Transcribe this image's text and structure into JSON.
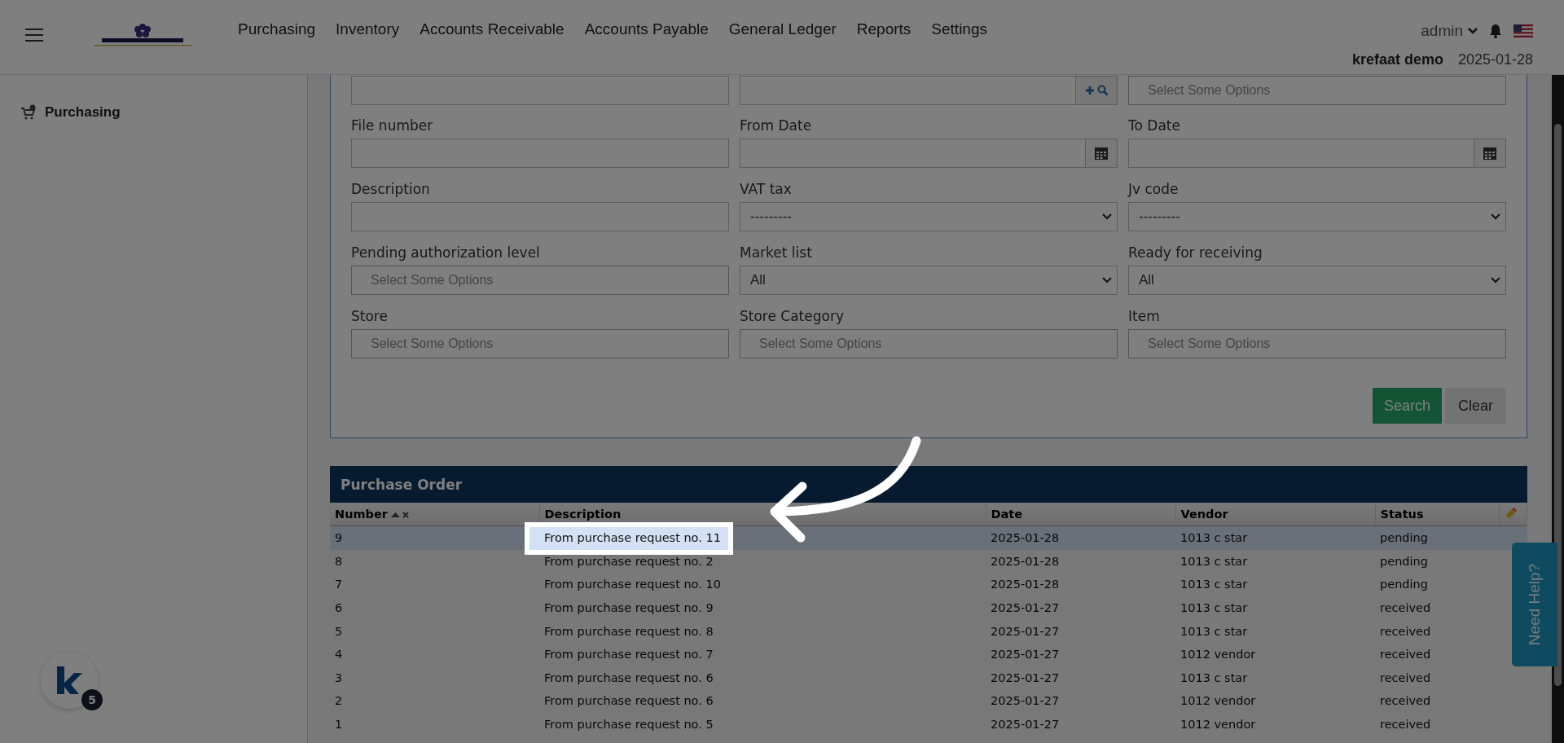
{
  "header": {
    "nav": [
      "Purchasing",
      "Inventory",
      "Accounts Receivable",
      "Accounts Payable",
      "General Ledger",
      "Reports",
      "Settings"
    ],
    "user": "admin",
    "company": "krefaat demo",
    "date": "2025-01-28"
  },
  "sidebar": {
    "items": [
      {
        "label": "Purchasing",
        "selected": false
      }
    ]
  },
  "filter_form": {
    "top_fields": [
      {
        "kind": "text"
      },
      {
        "kind": "lookup"
      },
      {
        "kind": "multi",
        "placeholder": "Select Some Options"
      }
    ],
    "fields": [
      {
        "label": "File number",
        "kind": "text"
      },
      {
        "label": "From Date",
        "kind": "date"
      },
      {
        "label": "To Date",
        "kind": "date"
      },
      {
        "label": "Description",
        "kind": "text"
      },
      {
        "label": "VAT tax",
        "kind": "select",
        "value": "---------"
      },
      {
        "label": "Jv code",
        "kind": "select",
        "value": "---------"
      },
      {
        "label": "Pending authorization level",
        "kind": "multi",
        "placeholder": "Select Some Options"
      },
      {
        "label": "Market list",
        "kind": "select",
        "value": "All"
      },
      {
        "label": "Ready for receiving",
        "kind": "select",
        "value": "All"
      },
      {
        "label": "Store",
        "kind": "multi",
        "placeholder": "Select Some Options"
      },
      {
        "label": "Store Category",
        "kind": "multi",
        "placeholder": "Select Some Options"
      },
      {
        "label": "Item",
        "kind": "multi",
        "placeholder": "Select Some Options"
      }
    ],
    "buttons": [
      "Search",
      "Clear"
    ]
  },
  "table": {
    "title": "Purchase Order",
    "columns": [
      "Number",
      "Description",
      "Date",
      "Vendor",
      "Status"
    ],
    "rows": [
      {
        "number": "9",
        "description": "From purchase request no. 11",
        "date": "2025-01-28",
        "vendor": "1013 c star",
        "status": "pending",
        "selected": true
      },
      {
        "number": "8",
        "description": "From purchase request no. 2",
        "date": "2025-01-28",
        "vendor": "1013 c star",
        "status": "pending",
        "selected": false
      },
      {
        "number": "7",
        "description": "From purchase request no. 10",
        "date": "2025-01-28",
        "vendor": "1013 c star",
        "status": "pending",
        "selected": false
      },
      {
        "number": "6",
        "description": "From purchase request no. 9",
        "date": "2025-01-27",
        "vendor": "1013 c star",
        "status": "received",
        "selected": false
      },
      {
        "number": "5",
        "description": "From purchase request no. 8",
        "date": "2025-01-27",
        "vendor": "1013 c star",
        "status": "received",
        "selected": false
      },
      {
        "number": "4",
        "description": "From purchase request no. 7",
        "date": "2025-01-27",
        "vendor": "1012 vendor",
        "status": "received",
        "selected": false
      },
      {
        "number": "3",
        "description": "From purchase request no. 6",
        "date": "2025-01-27",
        "vendor": "1013 c star",
        "status": "received",
        "selected": false
      },
      {
        "number": "2",
        "description": "From purchase request no. 6",
        "date": "2025-01-27",
        "vendor": "1012 vendor",
        "status": "received",
        "selected": false
      },
      {
        "number": "1",
        "description": "From purchase request no. 5",
        "date": "2025-01-27",
        "vendor": "1012 vendor",
        "status": "received",
        "selected": false
      }
    ]
  },
  "help_tab": "Need Help?",
  "launcher_badge": "5"
}
